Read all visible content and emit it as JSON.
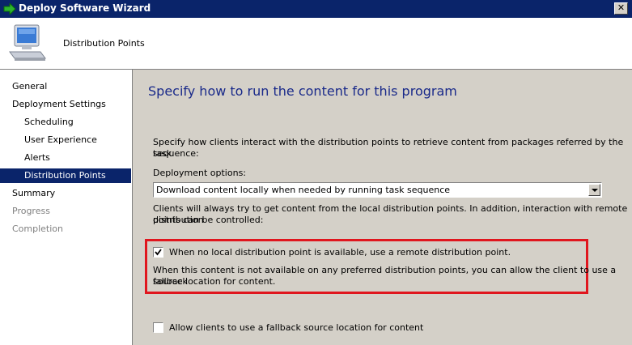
{
  "window": {
    "title": "Deploy Software Wizard",
    "close_glyph": "✕"
  },
  "header": {
    "heading": "Distribution Points",
    "icon": "computer-icon"
  },
  "nav": {
    "items": [
      {
        "label": "General",
        "level": 0,
        "state": "normal"
      },
      {
        "label": "Deployment Settings",
        "level": 0,
        "state": "normal"
      },
      {
        "label": "Scheduling",
        "level": 1,
        "state": "normal"
      },
      {
        "label": "User Experience",
        "level": 1,
        "state": "normal"
      },
      {
        "label": "Alerts",
        "level": 1,
        "state": "normal"
      },
      {
        "label": "Distribution Points",
        "level": 1,
        "state": "selected"
      },
      {
        "label": "Summary",
        "level": 0,
        "state": "normal"
      },
      {
        "label": "Progress",
        "level": 0,
        "state": "disabled"
      },
      {
        "label": "Completion",
        "level": 0,
        "state": "disabled"
      }
    ]
  },
  "main": {
    "title": "Specify how to run the content for this program",
    "description_line1": "Specify how clients interact with the distribution points to retrieve content from packages referred by the task",
    "description_line2": "sequence:",
    "deployment_options_label": "Deployment options:",
    "deployment_option_value": "Download content locally when needed by running task sequence",
    "info_line1": "Clients will always try to get content from the local distribution points. In addition, interaction with remote distribution",
    "info_line2": "points can be controlled:",
    "remote_dp_checkbox": {
      "label": "When no local distribution point is available, use a remote distribution point.",
      "checked": true
    },
    "fallback_info_line1": "When this content is not available on any preferred distribution points, you can allow the client to use a fallback",
    "fallback_info_line2": "source location for content.",
    "fallback_checkbox": {
      "label": "Allow clients to use a fallback source location for content",
      "checked": false
    }
  },
  "colors": {
    "titlebar": "#0a246a",
    "selected": "#0a246a",
    "highlight_box": "#e0161e",
    "page_title": "#1a2a8a"
  }
}
